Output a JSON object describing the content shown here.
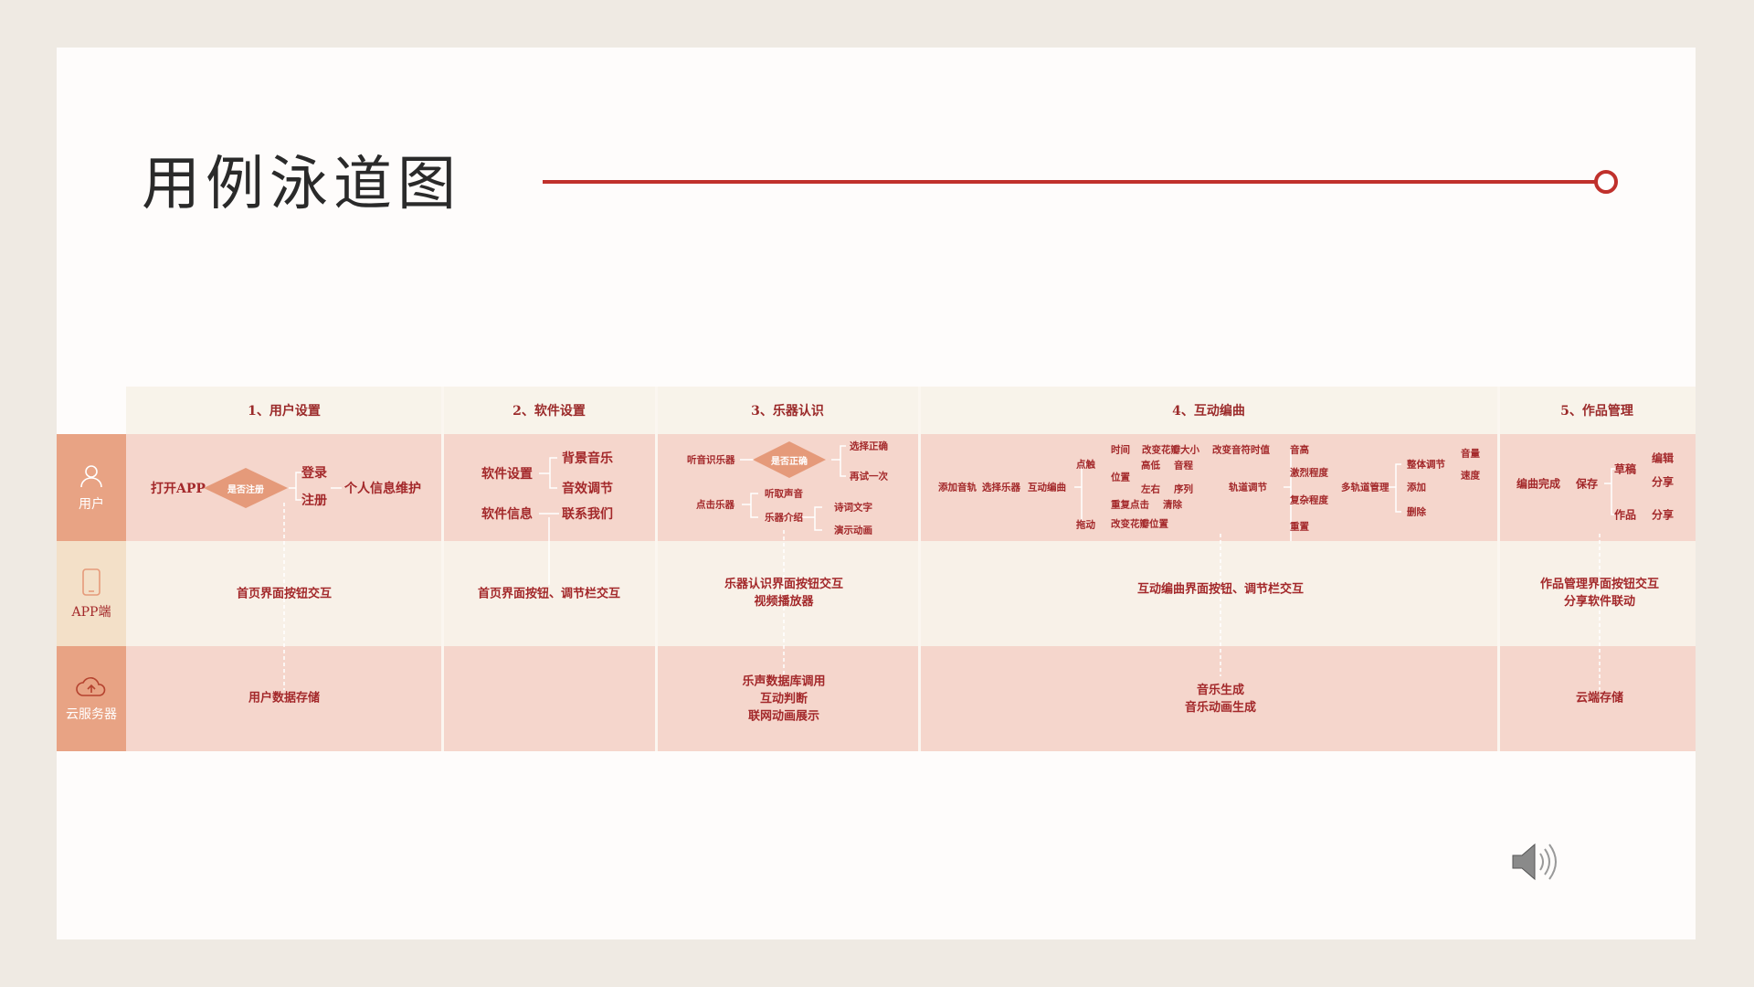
{
  "title": "用例泳道图",
  "lanes": {
    "user": "用户",
    "app": "APP端",
    "cloud": "云服务器"
  },
  "columns": [
    "1、用户设置",
    "2、软件设置",
    "3、乐器认识",
    "4、互动编曲",
    "5、作品管理"
  ],
  "col1": {
    "open": "打开APP",
    "decision": "是否注册",
    "login": "登录",
    "register": "注册",
    "profile": "个人信息维护",
    "app": "首页界面按钮交互",
    "cloud": "用户数据存储"
  },
  "col2": {
    "settings": "软件设置",
    "info": "软件信息",
    "bgm": "背景音乐",
    "sfx": "音效调节",
    "contact": "联系我们",
    "app": "首页界面按钮、调节栏交互"
  },
  "col3": {
    "listen": "听音识乐器",
    "decision": "是否正确",
    "correct": "选择正确",
    "retry": "再试一次",
    "click": "点击乐器",
    "hear": "听取声音",
    "intro": "乐器介绍",
    "poem": "诗词文字",
    "anim": "演示动画",
    "app": [
      "乐器认识界面按钮交互",
      "视频播放器"
    ],
    "cloud": [
      "乐声数据库调用",
      "互动判断",
      "联网动画展示"
    ]
  },
  "col4": {
    "add_track": "添加音轨",
    "choose": "选择乐器",
    "compose": "互动编曲",
    "touch": "点触",
    "drag": "拖动",
    "time": "时间",
    "petal_size": "改变花瓣大小",
    "note_len": "改变音符时值",
    "position": "位置",
    "pitch_lv": "高低",
    "interval": "音程",
    "lr": "左右",
    "sequence": "序列",
    "repeat": "重复点击",
    "clear": "清除",
    "petal_pos": "改变花瓣位置",
    "track_adj": "轨道调节",
    "pitch": "音高",
    "intensity": "激烈程度",
    "complexity": "复杂程度",
    "reset": "重置",
    "multi": "多轨道管理",
    "overall": "整体调节",
    "add": "添加",
    "delete": "删除",
    "volume": "音量",
    "speed": "速度",
    "app": "互动编曲界面按钮、调节栏交互",
    "cloud": [
      "音乐生成",
      "音乐动画生成"
    ]
  },
  "col5": {
    "done": "编曲完成",
    "save": "保存",
    "draft": "草稿",
    "edit": "编辑",
    "share1": "分享",
    "work": "作品",
    "share2": "分享",
    "app": [
      "作品管理界面按钮交互",
      "分享软件联动"
    ],
    "cloud": "云端存储"
  },
  "colors": {
    "accent": "#c0312c",
    "lane_label": "#e8a384",
    "lane_pink": "#f5d6cc",
    "lane_cream": "#f8f1e8"
  }
}
